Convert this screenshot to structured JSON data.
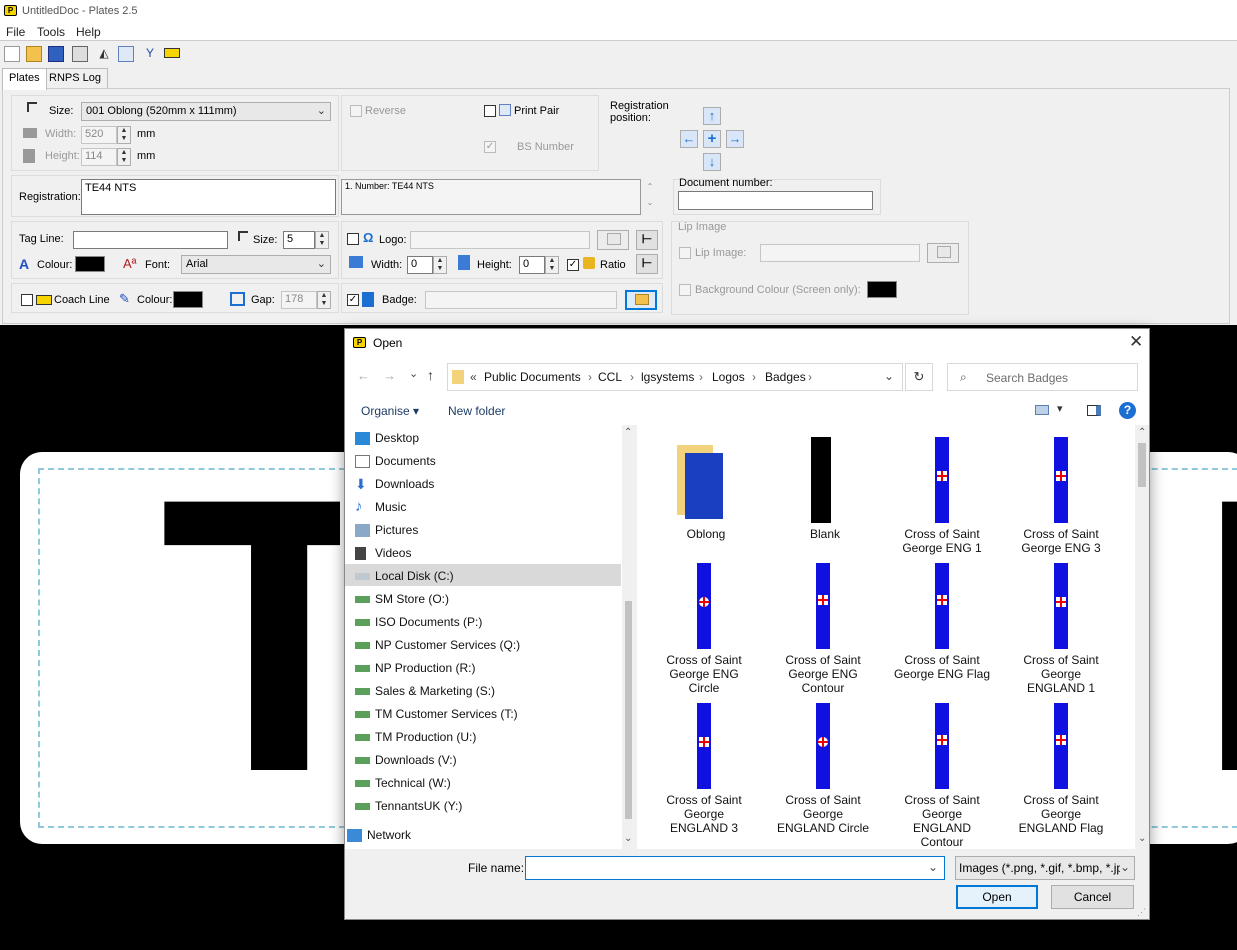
{
  "window": {
    "title": "UntitledDoc - Plates 2.5",
    "logo_letter": "P"
  },
  "menu": [
    "File",
    "Tools",
    "Help"
  ],
  "tabs": [
    "Plates",
    "RNPS Log"
  ],
  "plates": {
    "size_label": "Size:",
    "size_value": "001 Oblong (520mm x 111mm)",
    "width_label": "Width:",
    "width_value": "520",
    "height_label": "Height:",
    "height_value": "114",
    "unit": "mm",
    "reverse_label": "Reverse",
    "print_pair_label": "Print Pair",
    "bs_number_label": "BS Number",
    "registration_position_label": "Registration position:",
    "registration_label": "Registration:",
    "registration_value": "TE44 NTS",
    "preview_text": "1. Number: TE44 NTS",
    "document_number_label": "Document number:",
    "document_number_value": "",
    "tag_line_label": "Tag Line:",
    "tag_line_value": "",
    "tag_size_label": "Size:",
    "tag_size_value": "5",
    "colour_label": "Colour:",
    "font_label": "Font:",
    "font_value": "Arial",
    "logo_label": "Logo:",
    "logo_value": "",
    "logo_width_label": "Width:",
    "logo_width_value": "0",
    "logo_height_label": "Height:",
    "logo_height_value": "0",
    "ratio_label": "Ratio",
    "coach_line_label": "Coach Line",
    "coach_colour_label": "Colour:",
    "gap_label": "Gap:",
    "gap_value": "178",
    "badge_label": "Badge:",
    "badge_value": "",
    "lip_image_group": "Lip Image",
    "lip_image_label": "Lip Image:",
    "background_colour_label": "Background Colour (Screen only):"
  },
  "dialog": {
    "title": "Open",
    "breadcrumb": [
      "Public Documents",
      "CCL",
      "lgsystems",
      "Logos",
      "Badges"
    ],
    "search_placeholder": "Search Badges",
    "organise_label": "Organise",
    "new_folder_label": "New folder",
    "nav_items": [
      "Desktop",
      "Documents",
      "Downloads",
      "Music",
      "Pictures",
      "Videos",
      "Local Disk (C:)",
      "SM Store (O:)",
      "ISO Documents (P:)",
      "NP Customer Services (Q:)",
      "NP Production (R:)",
      "Sales & Marketing (S:)",
      "TM Customer Services (T:)",
      "TM Production (U:)",
      "Downloads (V:)",
      "Technical (W:)",
      "TennantsUK (Y:)",
      "Network"
    ],
    "files": [
      [
        "Oblong"
      ],
      [
        "Blank"
      ],
      [
        "Cross of Saint",
        "George ENG 1"
      ],
      [
        "Cross of Saint",
        "George ENG 3"
      ],
      [
        "Cross of Saint",
        "George ENG",
        "Circle"
      ],
      [
        "Cross of Saint",
        "George ENG",
        "Contour"
      ],
      [
        "Cross of Saint",
        "George ENG Flag"
      ],
      [
        "Cross of Saint",
        "George",
        "ENGLAND 1"
      ],
      [
        "Cross of Saint",
        "George",
        "ENGLAND 3"
      ],
      [
        "Cross of Saint",
        "George",
        "ENGLAND Circle"
      ],
      [
        "Cross of Saint",
        "George",
        "ENGLAND",
        "Contour"
      ],
      [
        "Cross of Saint",
        "George",
        "ENGLAND Flag"
      ]
    ],
    "file_name_label": "File name:",
    "file_name_value": "",
    "filter_value": "Images (*.png, *.gif, *.bmp, *.jp",
    "open_label": "Open",
    "cancel_label": "Cancel"
  },
  "plate_preview_chars": [
    "T",
    "N"
  ],
  "colors": {
    "accent": "#0078d7",
    "flag_blue": "#1010e0",
    "cross_red": "#e00000",
    "plate_bg": "#ffffff",
    "canvas_bg": "#000000"
  }
}
